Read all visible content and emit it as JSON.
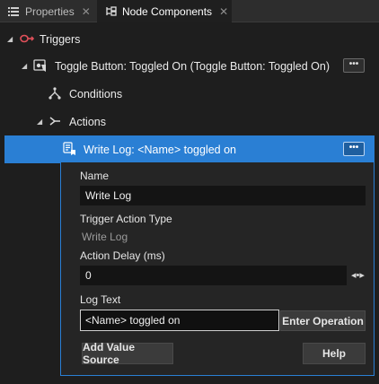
{
  "tabs": [
    {
      "label": "Properties",
      "icon": "list-icon",
      "close": "✕"
    },
    {
      "label": "Node Components",
      "icon": "node-components-icon",
      "close": "✕"
    }
  ],
  "tree": {
    "triggers": {
      "label": "Triggers",
      "icon": "triggers-icon"
    },
    "trigger_item": {
      "label": "Toggle Button: Toggled On (Toggle Button: Toggled On)",
      "icon": "trigger-item-icon",
      "menu": "•••"
    },
    "conditions": {
      "label": "Conditions",
      "icon": "conditions-icon"
    },
    "actions": {
      "label": "Actions",
      "icon": "actions-icon"
    },
    "action_item": {
      "label": "Write Log: <Name> toggled on",
      "icon": "write-log-icon",
      "menu": "•••"
    }
  },
  "details": {
    "name_label": "Name",
    "name_value": "Write Log",
    "type_label": "Trigger Action Type",
    "type_value": "Write Log",
    "delay_label": "Action Delay (ms)",
    "delay_value": "0",
    "log_label": "Log Text",
    "log_value": "<Name> toggled on",
    "enter_operation": "Enter Operation",
    "add_value_source": "Add Value Source",
    "help": "Help"
  },
  "colors": {
    "accent": "#2a7fd4",
    "background": "#1e1e1e"
  }
}
